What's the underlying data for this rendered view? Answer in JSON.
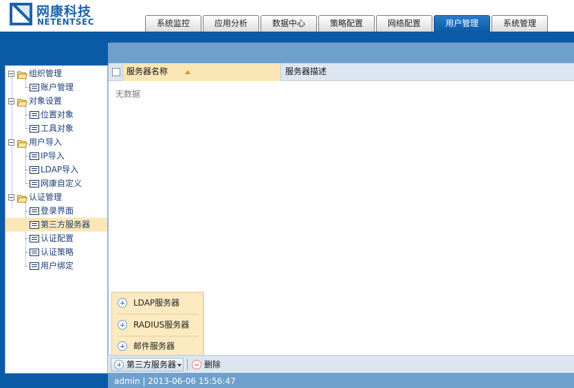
{
  "brand": {
    "name_cn": "网康科技",
    "name_en": "NETENTSEC"
  },
  "nav": {
    "tabs": [
      {
        "label": "系统监控"
      },
      {
        "label": "应用分析"
      },
      {
        "label": "数据中心"
      },
      {
        "label": "策略配置"
      },
      {
        "label": "网络配置"
      },
      {
        "label": "用户管理"
      },
      {
        "label": "系统管理"
      }
    ],
    "active_tab": "用户管理"
  },
  "sidebar": {
    "groups": [
      {
        "label": "组织管理",
        "items": [
          {
            "label": "账户管理"
          }
        ]
      },
      {
        "label": "对象设置",
        "items": [
          {
            "label": "位置对象"
          },
          {
            "label": "工具对象"
          }
        ]
      },
      {
        "label": "用户导入",
        "items": [
          {
            "label": "IP导入"
          },
          {
            "label": "LDAP导入"
          },
          {
            "label": "网康自定义"
          }
        ]
      },
      {
        "label": "认证管理",
        "items": [
          {
            "label": "登录界面"
          },
          {
            "label": "第三方服务器"
          },
          {
            "label": "认证配置"
          },
          {
            "label": "认证策略"
          },
          {
            "label": "用户绑定"
          }
        ]
      }
    ],
    "selected_item": "第三方服务器"
  },
  "grid": {
    "columns": [
      {
        "label": "服务器名称"
      },
      {
        "label": "服务器描述"
      }
    ],
    "empty_text": "无数据"
  },
  "add_menu": {
    "items": [
      {
        "label": "LDAP服务器"
      },
      {
        "label": "RADIUS服务器"
      },
      {
        "label": "邮件服务器"
      }
    ]
  },
  "toolbar": {
    "add_label": "第三方服务器",
    "delete_label": "删除"
  },
  "status": {
    "text": "admin | 2013-06-06 15:56:47"
  },
  "colors": {
    "brand_blue": "#0b5aa6",
    "panel_blue": "#6f9fcb",
    "highlight": "#fbe6b6"
  }
}
